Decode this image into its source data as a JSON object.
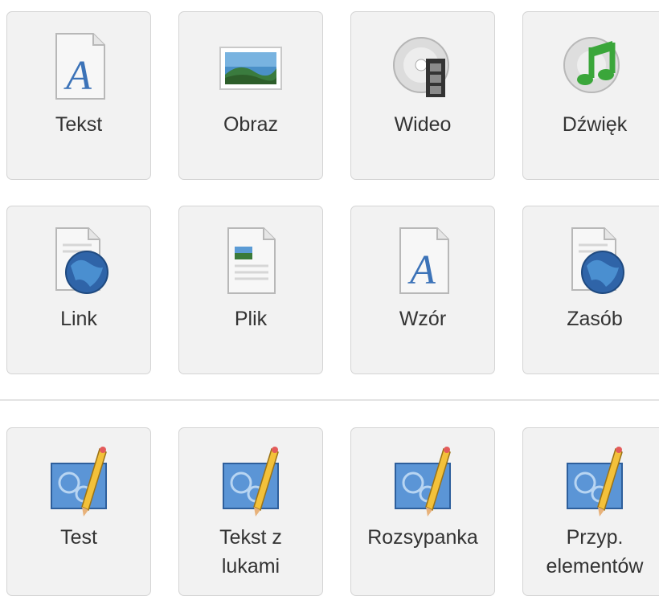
{
  "tiles": {
    "text": {
      "label": "Tekst",
      "icon": "text-document-icon"
    },
    "image": {
      "label": "Obraz",
      "icon": "image-icon"
    },
    "video": {
      "label": "Wideo",
      "icon": "video-icon"
    },
    "audio": {
      "label": "Dźwięk",
      "icon": "music-icon"
    },
    "link": {
      "label": "Link",
      "icon": "globe-document-icon"
    },
    "file": {
      "label": "Plik",
      "icon": "file-icon"
    },
    "formula": {
      "label": "Wzór",
      "icon": "formula-icon"
    },
    "resource": {
      "label": "Zasób",
      "icon": "globe-document-icon"
    }
  },
  "exercises": [
    {
      "label": "Test",
      "icon": "blueprint-pencil-icon"
    },
    {
      "label": "Tekst z\nlukami",
      "icon": "blueprint-pencil-icon"
    },
    {
      "label": "Rozsypanka",
      "icon": "blueprint-pencil-icon"
    },
    {
      "label": "Przyp.\nelementów",
      "icon": "blueprint-pencil-icon"
    }
  ]
}
